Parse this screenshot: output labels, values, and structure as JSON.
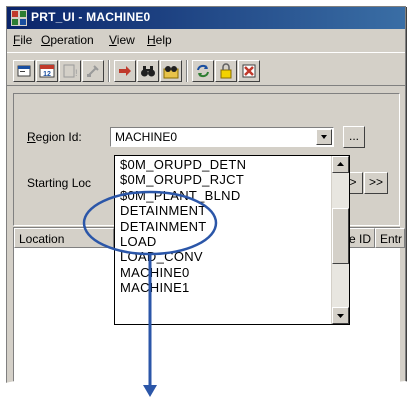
{
  "window": {
    "title": "PRT_UI - MACHINE0"
  },
  "menubar": {
    "items": [
      {
        "label": "File"
      },
      {
        "label": "Operation"
      },
      {
        "label": "View"
      },
      {
        "label": "Help"
      }
    ]
  },
  "toolbar": {
    "buttons": [
      {
        "icon": "new-window-icon"
      },
      {
        "icon": "calendar-icon"
      },
      {
        "icon": "disabled-edit-icon"
      },
      {
        "icon": "disabled-tools-icon"
      },
      {
        "icon": "arrow-right-icon"
      },
      {
        "icon": "binoculars-icon"
      },
      {
        "icon": "binoculars-folder-icon"
      },
      {
        "icon": "refresh-icon"
      },
      {
        "icon": "lock-icon"
      },
      {
        "icon": "delete-icon"
      }
    ]
  },
  "form": {
    "region_label": "Region Id:",
    "region_value": "MACHINE0",
    "browse_label": "...",
    "starting_label": "Starting Loc",
    "nav_next": ">",
    "nav_last": ">>"
  },
  "grid": {
    "columns": [
      {
        "label": "Location"
      },
      {
        "label": "e ID"
      },
      {
        "label": "Entr"
      }
    ]
  },
  "dropdown": {
    "items": [
      "$0M_ORUPD_DETN",
      "$0M_ORUPD_RJCT",
      "$0M_PLANT_BLND",
      "DETAINMENT",
      "DETAINMENT",
      "LOAD",
      "LOAD_CONV",
      "MACHINE0",
      "MACHINE1"
    ]
  },
  "annotation": {
    "color": "#2b56a8"
  }
}
